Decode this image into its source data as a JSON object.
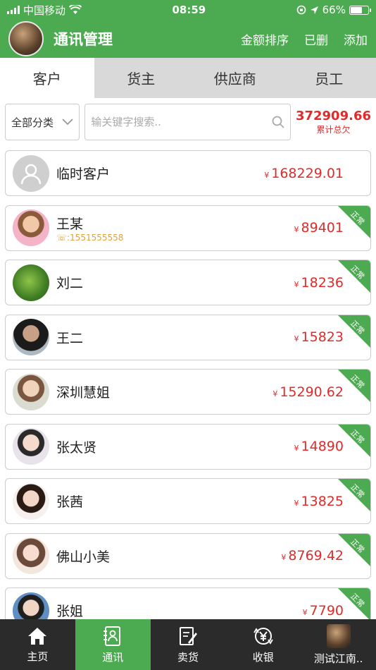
{
  "status": {
    "carrier": "中国移动",
    "time": "08:59",
    "battery": "66%"
  },
  "header": {
    "title": "通讯管理",
    "actions": [
      "金额排序",
      "已删",
      "添加"
    ]
  },
  "tabs": [
    "客户",
    "货主",
    "供应商",
    "员工"
  ],
  "filter": {
    "selected": "全部分类"
  },
  "search": {
    "placeholder": "输关键字搜索.."
  },
  "total": {
    "value": "372909.66",
    "label": "累计总欠"
  },
  "currency_symbol": "¥",
  "status_ribbon": "正常",
  "contacts": [
    {
      "name": "临时客户",
      "amount": "168229.01",
      "phone": "",
      "status": "",
      "avatar": "placeholder"
    },
    {
      "name": "王某",
      "amount": "89401",
      "phone": "1551555558",
      "status": "正常",
      "avatar": "woman-pink"
    },
    {
      "name": "刘二",
      "amount": "18236",
      "phone": "",
      "status": "正常",
      "avatar": "greenery"
    },
    {
      "name": "王二",
      "amount": "15823",
      "phone": "",
      "status": "正常",
      "avatar": "man-dark"
    },
    {
      "name": "深圳慧姐",
      "amount": "15290.62",
      "phone": "",
      "status": "正常",
      "avatar": "woman-light"
    },
    {
      "name": "张太贤",
      "amount": "14890",
      "phone": "",
      "status": "正常",
      "avatar": "man-light"
    },
    {
      "name": "张茜",
      "amount": "13825",
      "phone": "",
      "status": "正常",
      "avatar": "woman-red"
    },
    {
      "name": "佛山小美",
      "amount": "8769.42",
      "phone": "",
      "status": "正常",
      "avatar": "woman-drawn"
    },
    {
      "name": "张姐",
      "amount": "7790",
      "phone": "",
      "status": "正常",
      "avatar": "woman-blue"
    }
  ],
  "bottom_nav": [
    {
      "label": "主页",
      "icon": "home-icon"
    },
    {
      "label": "通讯",
      "icon": "contacts-icon"
    },
    {
      "label": "卖货",
      "icon": "sell-icon"
    },
    {
      "label": "收银",
      "icon": "cashier-icon"
    },
    {
      "label": "测试江南..",
      "icon": "profile-avatar"
    }
  ],
  "colors": {
    "brand_green": "#4caa50",
    "amount_red": "#e02b2b",
    "phone_orange": "#e4a23a",
    "nav_dark": "#2b2b2b"
  }
}
